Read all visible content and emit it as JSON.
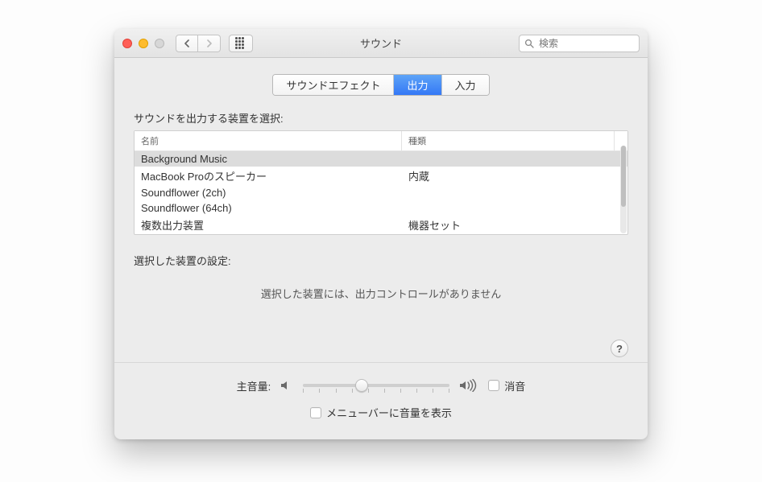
{
  "window": {
    "title": "サウンド"
  },
  "search": {
    "placeholder": "検索"
  },
  "tabs": {
    "effects": "サウンドエフェクト",
    "output": "出力",
    "input": "入力",
    "active": "output"
  },
  "section": {
    "select_device": "サウンドを出力する装置を選択:",
    "col_name": "名前",
    "col_type": "種類"
  },
  "devices": [
    {
      "name": "Background Music",
      "type": "",
      "selected": true
    },
    {
      "name": "MacBook Proのスピーカー",
      "type": "内蔵",
      "selected": false
    },
    {
      "name": "Soundflower (2ch)",
      "type": "",
      "selected": false
    },
    {
      "name": "Soundflower (64ch)",
      "type": "",
      "selected": false
    },
    {
      "name": "複数出力装置",
      "type": "機器セット",
      "selected": false
    }
  ],
  "settings": {
    "label": "選択した装置の設定:",
    "no_controls": "選択した装置には、出力コントロールがありません"
  },
  "volume": {
    "label": "主音量:",
    "percent": 40,
    "mute_label": "消音",
    "show_in_menubar": "メニューバーに音量を表示"
  },
  "help": {
    "symbol": "?"
  }
}
